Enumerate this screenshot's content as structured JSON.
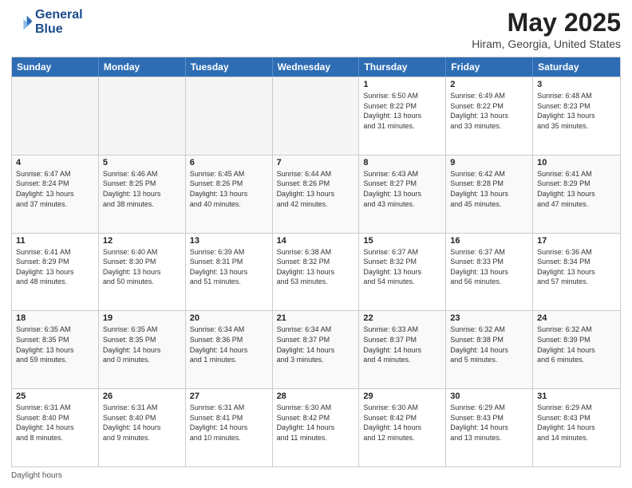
{
  "header": {
    "logo_line1": "General",
    "logo_line2": "Blue",
    "main_title": "May 2025",
    "sub_title": "Hiram, Georgia, United States"
  },
  "weekdays": [
    "Sunday",
    "Monday",
    "Tuesday",
    "Wednesday",
    "Thursday",
    "Friday",
    "Saturday"
  ],
  "footer_label": "Daylight hours",
  "weeks": [
    [
      {
        "day": "",
        "info": ""
      },
      {
        "day": "",
        "info": ""
      },
      {
        "day": "",
        "info": ""
      },
      {
        "day": "",
        "info": ""
      },
      {
        "day": "1",
        "info": "Sunrise: 6:50 AM\nSunset: 8:22 PM\nDaylight: 13 hours\nand 31 minutes."
      },
      {
        "day": "2",
        "info": "Sunrise: 6:49 AM\nSunset: 8:22 PM\nDaylight: 13 hours\nand 33 minutes."
      },
      {
        "day": "3",
        "info": "Sunrise: 6:48 AM\nSunset: 8:23 PM\nDaylight: 13 hours\nand 35 minutes."
      }
    ],
    [
      {
        "day": "4",
        "info": "Sunrise: 6:47 AM\nSunset: 8:24 PM\nDaylight: 13 hours\nand 37 minutes."
      },
      {
        "day": "5",
        "info": "Sunrise: 6:46 AM\nSunset: 8:25 PM\nDaylight: 13 hours\nand 38 minutes."
      },
      {
        "day": "6",
        "info": "Sunrise: 6:45 AM\nSunset: 8:26 PM\nDaylight: 13 hours\nand 40 minutes."
      },
      {
        "day": "7",
        "info": "Sunrise: 6:44 AM\nSunset: 8:26 PM\nDaylight: 13 hours\nand 42 minutes."
      },
      {
        "day": "8",
        "info": "Sunrise: 6:43 AM\nSunset: 8:27 PM\nDaylight: 13 hours\nand 43 minutes."
      },
      {
        "day": "9",
        "info": "Sunrise: 6:42 AM\nSunset: 8:28 PM\nDaylight: 13 hours\nand 45 minutes."
      },
      {
        "day": "10",
        "info": "Sunrise: 6:41 AM\nSunset: 8:29 PM\nDaylight: 13 hours\nand 47 minutes."
      }
    ],
    [
      {
        "day": "11",
        "info": "Sunrise: 6:41 AM\nSunset: 8:29 PM\nDaylight: 13 hours\nand 48 minutes."
      },
      {
        "day": "12",
        "info": "Sunrise: 6:40 AM\nSunset: 8:30 PM\nDaylight: 13 hours\nand 50 minutes."
      },
      {
        "day": "13",
        "info": "Sunrise: 6:39 AM\nSunset: 8:31 PM\nDaylight: 13 hours\nand 51 minutes."
      },
      {
        "day": "14",
        "info": "Sunrise: 6:38 AM\nSunset: 8:32 PM\nDaylight: 13 hours\nand 53 minutes."
      },
      {
        "day": "15",
        "info": "Sunrise: 6:37 AM\nSunset: 8:32 PM\nDaylight: 13 hours\nand 54 minutes."
      },
      {
        "day": "16",
        "info": "Sunrise: 6:37 AM\nSunset: 8:33 PM\nDaylight: 13 hours\nand 56 minutes."
      },
      {
        "day": "17",
        "info": "Sunrise: 6:36 AM\nSunset: 8:34 PM\nDaylight: 13 hours\nand 57 minutes."
      }
    ],
    [
      {
        "day": "18",
        "info": "Sunrise: 6:35 AM\nSunset: 8:35 PM\nDaylight: 13 hours\nand 59 minutes."
      },
      {
        "day": "19",
        "info": "Sunrise: 6:35 AM\nSunset: 8:35 PM\nDaylight: 14 hours\nand 0 minutes."
      },
      {
        "day": "20",
        "info": "Sunrise: 6:34 AM\nSunset: 8:36 PM\nDaylight: 14 hours\nand 1 minutes."
      },
      {
        "day": "21",
        "info": "Sunrise: 6:34 AM\nSunset: 8:37 PM\nDaylight: 14 hours\nand 3 minutes."
      },
      {
        "day": "22",
        "info": "Sunrise: 6:33 AM\nSunset: 8:37 PM\nDaylight: 14 hours\nand 4 minutes."
      },
      {
        "day": "23",
        "info": "Sunrise: 6:32 AM\nSunset: 8:38 PM\nDaylight: 14 hours\nand 5 minutes."
      },
      {
        "day": "24",
        "info": "Sunrise: 6:32 AM\nSunset: 8:39 PM\nDaylight: 14 hours\nand 6 minutes."
      }
    ],
    [
      {
        "day": "25",
        "info": "Sunrise: 6:31 AM\nSunset: 8:40 PM\nDaylight: 14 hours\nand 8 minutes."
      },
      {
        "day": "26",
        "info": "Sunrise: 6:31 AM\nSunset: 8:40 PM\nDaylight: 14 hours\nand 9 minutes."
      },
      {
        "day": "27",
        "info": "Sunrise: 6:31 AM\nSunset: 8:41 PM\nDaylight: 14 hours\nand 10 minutes."
      },
      {
        "day": "28",
        "info": "Sunrise: 6:30 AM\nSunset: 8:42 PM\nDaylight: 14 hours\nand 11 minutes."
      },
      {
        "day": "29",
        "info": "Sunrise: 6:30 AM\nSunset: 8:42 PM\nDaylight: 14 hours\nand 12 minutes."
      },
      {
        "day": "30",
        "info": "Sunrise: 6:29 AM\nSunset: 8:43 PM\nDaylight: 14 hours\nand 13 minutes."
      },
      {
        "day": "31",
        "info": "Sunrise: 6:29 AM\nSunset: 8:43 PM\nDaylight: 14 hours\nand 14 minutes."
      }
    ]
  ]
}
